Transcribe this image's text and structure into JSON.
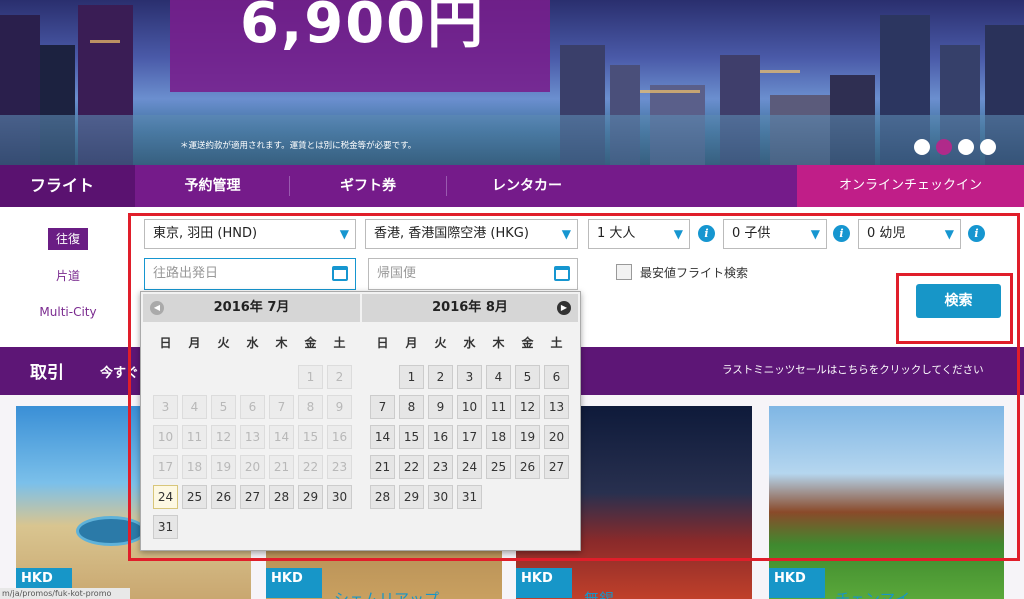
{
  "hero": {
    "price": "6,900円",
    "note": "＊運送約款が適用されます。運賃とは別に税金等が必要です。"
  },
  "nav": {
    "flight": "フライト",
    "manage": "予約管理",
    "gift": "ギフト券",
    "rental": "レンタカー",
    "checkin": "オンラインチェックイン"
  },
  "trip": {
    "round": "往復",
    "oneway": "片道",
    "multi": "Multi-City"
  },
  "search": {
    "origin": "東京, 羽田 (HND)",
    "destination": "香港, 香港国際空港 (HKG)",
    "adults": "1 大人",
    "children": "0 子供",
    "infants": "0 幼児",
    "depart_placeholder": "往路出発日",
    "return_placeholder": "帰国便",
    "lowest_fare": "最安値フライト検索",
    "search_button": "検索"
  },
  "calendar": {
    "weekdays": [
      "日",
      "月",
      "火",
      "水",
      "木",
      "金",
      "土"
    ],
    "months": [
      {
        "title": "2016年 7月"
      },
      {
        "title": "2016年 8月"
      }
    ]
  },
  "deals": {
    "title": "取引",
    "subtitle": "今すぐ",
    "last_minute": "ラストミニッツセールはこちらをクリックしてください",
    "cards": [
      {
        "currency": "HKD",
        "name": ""
      },
      {
        "currency": "HKD",
        "name": "シェムリアップ"
      },
      {
        "currency": "HKD",
        "name": "無錫"
      },
      {
        "currency": "HKD",
        "name": "チェンマイ"
      }
    ]
  },
  "status_url": "m/ja/promos/fuk-kot-promo",
  "colors": {
    "brand_purple": "#751b8a",
    "accent_blue": "#1796c8",
    "checkin_pink": "#c01e88",
    "highlight_red": "#e01e2a"
  }
}
